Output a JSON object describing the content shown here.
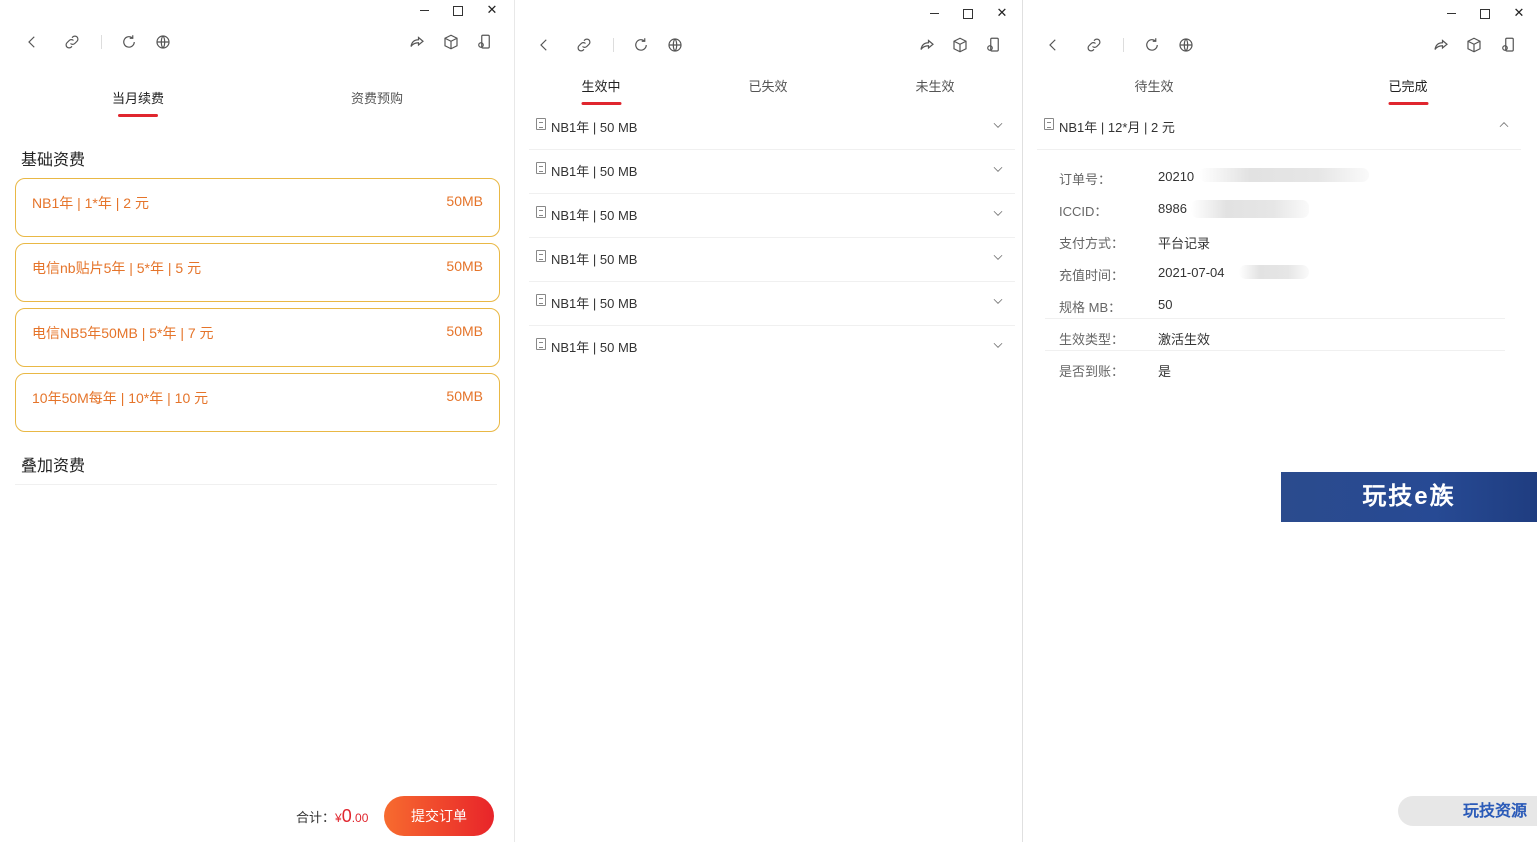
{
  "window_controls": {
    "minimize": "–",
    "maximize": "□",
    "close": "✕"
  },
  "toolbar": {
    "icons": [
      "back-icon",
      "link-icon",
      "refresh-icon",
      "globe-icon",
      "share-icon",
      "cube-icon",
      "mini-phone-icon"
    ]
  },
  "panel1": {
    "tabs": [
      {
        "label": "当月续费",
        "active": true
      },
      {
        "label": "资费预购",
        "active": false
      }
    ],
    "base_section_title": "基础资费",
    "addon_section_title": "叠加资费",
    "plans": [
      {
        "name": "NB1年 | 1*年 | 2 元",
        "size": "50MB"
      },
      {
        "name": "电信nb贴片5年 | 5*年 | 5 元",
        "size": "50MB"
      },
      {
        "name": "电信NB5年50MB | 5*年 | 7 元",
        "size": "50MB"
      },
      {
        "name": "10年50M每年 | 10*年 | 10 元",
        "size": "50MB"
      }
    ],
    "total_label": "合计：",
    "total_currency": "¥",
    "total_int": "0",
    "total_dec": ".00",
    "submit_label": "提交订单"
  },
  "panel2": {
    "tabs": [
      {
        "label": "生效中",
        "active": true
      },
      {
        "label": "已失效",
        "active": false
      },
      {
        "label": "未生效",
        "active": false
      }
    ],
    "orders": [
      "NB1年 | 50 MB",
      "NB1年 | 50 MB",
      "NB1年 | 50 MB",
      "NB1年 | 50 MB",
      "NB1年 | 50 MB",
      "NB1年 | 50 MB"
    ]
  },
  "panel3": {
    "tabs": [
      {
        "label": "待生效",
        "active": false
      },
      {
        "label": "已完成",
        "active": true
      }
    ],
    "order_title": "NB1年 | 12*月 | 2 元",
    "details": [
      {
        "key": "订单号：",
        "value": "20210"
      },
      {
        "key": "ICCID：",
        "value": "8986"
      },
      {
        "key": "支付方式：",
        "value": "平台记录"
      },
      {
        "key": "充值时间：",
        "value": "2021-07-04"
      },
      {
        "key": "规格 MB：",
        "value": "50"
      },
      {
        "key": "生效类型：",
        "value": "激活生效"
      },
      {
        "key": "是否到账：",
        "value": "是"
      }
    ]
  },
  "watermark": {
    "top": "玩技e族",
    "bottom": "玩技资源"
  },
  "colors": {
    "accent": "#e0262e",
    "plan_border": "#e9b845",
    "plan_text": "#e5742a"
  }
}
